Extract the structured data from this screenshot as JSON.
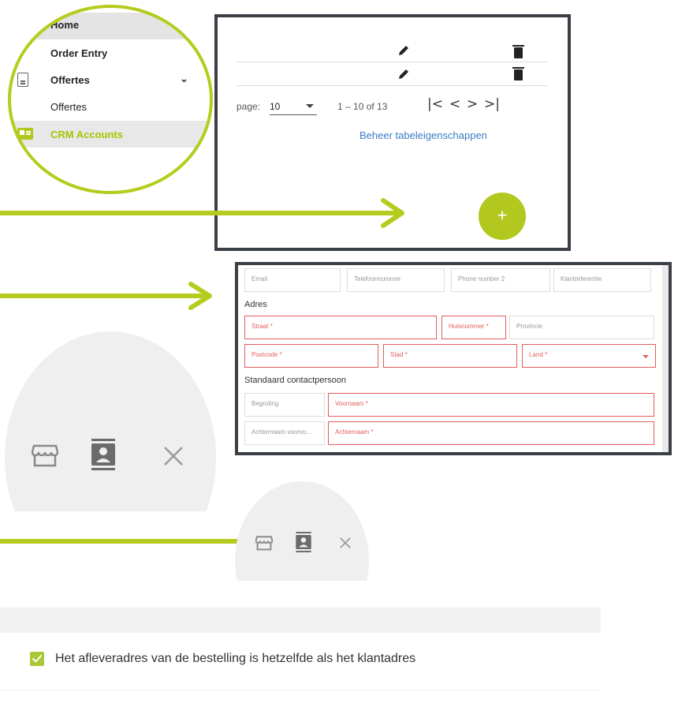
{
  "sidebar": {
    "items": [
      {
        "label": "Home"
      },
      {
        "label": "Order Entry"
      },
      {
        "label": "Offertes"
      },
      {
        "label": "Offertes"
      },
      {
        "label": "CRM Accounts"
      }
    ]
  },
  "table": {
    "page_label": "page:",
    "page_size": "10",
    "range_text": "1 – 10 of 13",
    "first_glyph": "|<",
    "prev_glyph": "<",
    "next_glyph": ">",
    "last_glyph": ">|",
    "manage_link": "Beheer tabeleigenschappen",
    "fab_label": "+"
  },
  "form": {
    "fields": {
      "email": "Email",
      "phone": "Telefoonnummer",
      "phone2": "Phone number 2",
      "reference": "Klantreferentie",
      "street": "Straat *",
      "house_number": "Huisnummer *",
      "province": "Provincie",
      "postcode": "Postcode *",
      "city": "Stad *",
      "country": "Land *",
      "budget": "Begroting",
      "first_name": "Voornaam *",
      "last_name_prefix": "Achternaam voorvo...",
      "last_name": "Achternaam *"
    },
    "sections": {
      "address": "Adres",
      "default_contact": "Standaard contactpersoon"
    }
  },
  "actions": {
    "icons": [
      "store-icon",
      "contact-card-icon",
      "close-icon"
    ]
  },
  "checkbox": {
    "checked": true,
    "label": "Het afleveradres van de bestelling is hetzelfde als het klantadres"
  },
  "colors": {
    "accent": "#b3c81e",
    "required": "#e35c5c",
    "link": "#3c7dc4",
    "panel_border": "#3b3f46"
  }
}
